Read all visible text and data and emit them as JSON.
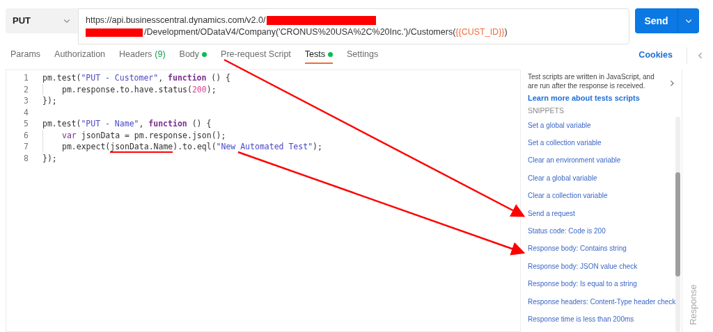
{
  "request": {
    "method": "PUT",
    "url_lines": [
      [
        {
          "kind": "plain",
          "text": "https://api.businesscentral.dynamics.com/v2.0/"
        }
      ],
      [
        {
          "kind": "plain",
          "text": "/Development/ODataV4/Company('CRONUS%20USA%2C%20Inc.')/Customers("
        },
        {
          "kind": "variable",
          "text": "{{CUST_ID}}"
        },
        {
          "kind": "plain",
          "text": ")"
        }
      ]
    ],
    "send": "Send"
  },
  "tabs": [
    {
      "label": "Params",
      "selected": false
    },
    {
      "label": "Authorization",
      "selected": false
    },
    {
      "label": "Headers",
      "count": "(9)",
      "selected": false
    },
    {
      "label": "Body",
      "dot": true,
      "selected": false
    },
    {
      "label": "Pre-request Script",
      "selected": false
    },
    {
      "label": "Tests",
      "dot": true,
      "selected": true
    },
    {
      "label": "Settings",
      "selected": false
    }
  ],
  "cookies": "Cookies",
  "editor": {
    "lines": [
      {
        "number": "1",
        "indent": false,
        "tokens": [
          {
            "kind": "plain",
            "text": "pm.test("
          },
          {
            "kind": "string",
            "text": "\"PUT - Customer\""
          },
          {
            "kind": "plain",
            "text": ", "
          },
          {
            "kind": "keyword",
            "text": "function"
          },
          {
            "kind": "plain",
            "text": " () {"
          }
        ]
      },
      {
        "number": "2",
        "indent": true,
        "tokens": [
          {
            "kind": "plain",
            "text": "pm.response.to.have.status("
          },
          {
            "kind": "number",
            "text": "200"
          },
          {
            "kind": "plain",
            "text": ");"
          }
        ]
      },
      {
        "number": "3",
        "indent": false,
        "tokens": [
          {
            "kind": "plain",
            "text": "});"
          }
        ]
      },
      {
        "number": "4"
      },
      {
        "number": "5",
        "indent": false,
        "tokens": [
          {
            "kind": "plain",
            "text": "pm.test("
          },
          {
            "kind": "string",
            "text": "\"PUT - Name\""
          },
          {
            "kind": "plain",
            "text": ", "
          },
          {
            "kind": "keyword",
            "text": "function"
          },
          {
            "kind": "plain",
            "text": " () {"
          }
        ]
      },
      {
        "number": "6",
        "indent": true,
        "tokens": [
          {
            "kind": "keyword-light",
            "text": "var"
          },
          {
            "kind": "plain",
            "text": " jsonData = pm.response.json();"
          }
        ]
      },
      {
        "number": "7",
        "indent": true,
        "tokens": [
          {
            "kind": "plain",
            "text": "pm.expect("
          },
          {
            "kind": "underlined",
            "text": "jsonData.Name"
          },
          {
            "kind": "plain",
            "text": ").to.eql("
          },
          {
            "kind": "string",
            "text": "\"New Automated Test\""
          },
          {
            "kind": "plain",
            "text": ");"
          }
        ]
      },
      {
        "number": "8",
        "indent": false,
        "tokens": [
          {
            "kind": "plain",
            "text": "});"
          }
        ]
      }
    ]
  },
  "help": {
    "text": "Test scripts are written in JavaScript, and are run after the response is received.",
    "link": "Learn more about tests scripts"
  },
  "snippets": {
    "title": "SNIPPETS",
    "items": [
      "Set a global variable",
      "Set a collection variable",
      "Clear an environment variable",
      "Clear a global variable",
      "Clear a collection variable",
      "Send a request",
      "Status code: Code is 200",
      "Response body: Contains string",
      "Response body: JSON value check",
      "Response body: Is equal to a string",
      "Response headers: Content-Type header check",
      "Response time is less than 200ms"
    ]
  },
  "response_label": "Response"
}
